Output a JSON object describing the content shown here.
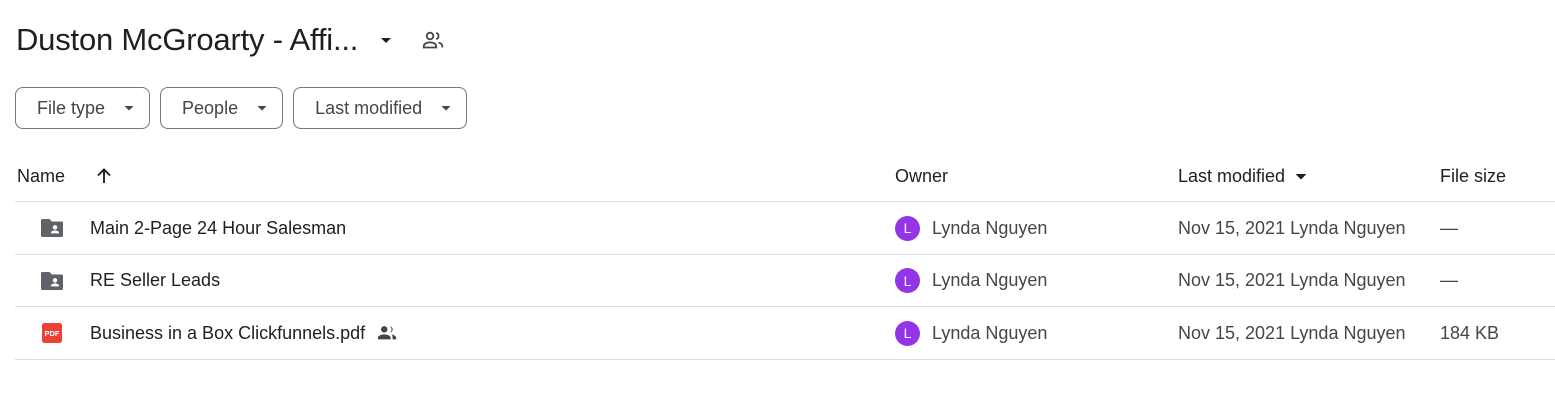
{
  "header": {
    "title": "Duston McGroarty - Affi...",
    "title_menu_icon": "arrow-drop-down-icon",
    "share_icon": "people-icon"
  },
  "filters": [
    {
      "label": "File type"
    },
    {
      "label": "People"
    },
    {
      "label": "Last modified"
    }
  ],
  "columns": {
    "name": "Name",
    "owner": "Owner",
    "last_modified": "Last modified",
    "file_size": "File size",
    "sort_icon": "arrow-upward-icon"
  },
  "rows": [
    {
      "name": "Main 2-Page 24 Hour Salesman",
      "icon": "shared-folder-icon",
      "shared": false,
      "owner": "Lynda Nguyen",
      "owner_initial": "L",
      "modified": "Nov 15, 2021 Lynda Nguyen",
      "size": "—"
    },
    {
      "name": "RE Seller Leads",
      "icon": "shared-folder-icon",
      "shared": false,
      "owner": "Lynda Nguyen",
      "owner_initial": "L",
      "modified": "Nov 15, 2021 Lynda Nguyen",
      "size": "—"
    },
    {
      "name": "Business in a Box Clickfunnels.pdf",
      "icon": "pdf-icon",
      "shared": true,
      "owner": "Lynda Nguyen",
      "owner_initial": "L",
      "modified": "Nov 15, 2021 Lynda Nguyen",
      "size": "184 KB"
    }
  ],
  "colors": {
    "avatar": "#9334e6",
    "pdf": "#ea4335",
    "folder": "#5f6368",
    "border": "#dadce0"
  }
}
